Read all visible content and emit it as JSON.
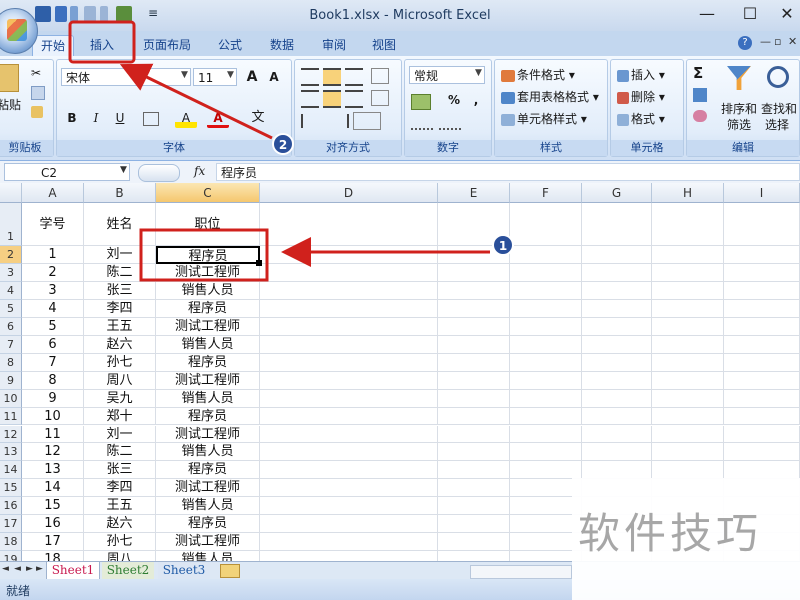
{
  "window": {
    "title": "Book1.xlsx - Microsoft Excel",
    "minimize": "—",
    "restore": "☐",
    "close": "✕"
  },
  "ribbon_controls": {
    "help": "?",
    "min": "—",
    "restore": "▫",
    "close": "✕"
  },
  "tabs": [
    {
      "label": "开始",
      "active": true
    },
    {
      "label": "插入",
      "active": false
    },
    {
      "label": "页面布局",
      "active": false
    },
    {
      "label": "公式",
      "active": false
    },
    {
      "label": "数据",
      "active": false
    },
    {
      "label": "审阅",
      "active": false
    },
    {
      "label": "视图",
      "active": false
    }
  ],
  "ribbon": {
    "clipboard": {
      "paste": "粘贴",
      "label": "剪贴板"
    },
    "font": {
      "name": "宋体",
      "size": "11",
      "grow": "A",
      "shrink": "A",
      "bold": "B",
      "italic": "I",
      "underline": "U",
      "fill": "A",
      "color": "A",
      "phonetic": "文",
      "label": "字体"
    },
    "alignment": {
      "label": "对齐方式"
    },
    "number": {
      "format": "常规",
      "percent": "%",
      "comma": ",",
      "label": "数字"
    },
    "styles": {
      "conditional": "条件格式",
      "table": "套用表格格式",
      "cell": "单元格样式",
      "label": "样式"
    },
    "cells": {
      "insert": "插入",
      "delete": "删除",
      "format": "格式",
      "label": "单元格"
    },
    "editing": {
      "sigma": "Σ",
      "sort": "排序和",
      "sort2": "筛选",
      "find": "查找和",
      "find2": "选择",
      "label": "编辑"
    }
  },
  "formula_bar": {
    "name_box": "C2",
    "fx": "fx",
    "content": "程序员"
  },
  "columns": [
    "A",
    "B",
    "C",
    "D",
    "E",
    "F",
    "G",
    "H",
    "I"
  ],
  "row_numbers": [
    "1",
    "2",
    "3",
    "4",
    "5",
    "6",
    "7",
    "8",
    "9",
    "10",
    "11",
    "12",
    "13",
    "14",
    "15",
    "16",
    "17",
    "18",
    "19"
  ],
  "header_row": [
    "学号",
    "姓名",
    "职位"
  ],
  "rows": [
    [
      "1",
      "刘一",
      "程序员"
    ],
    [
      "2",
      "陈二",
      "测试工程师"
    ],
    [
      "3",
      "张三",
      "销售人员"
    ],
    [
      "4",
      "李四",
      "程序员"
    ],
    [
      "5",
      "王五",
      "测试工程师"
    ],
    [
      "6",
      "赵六",
      "销售人员"
    ],
    [
      "7",
      "孙七",
      "程序员"
    ],
    [
      "8",
      "周八",
      "测试工程师"
    ],
    [
      "9",
      "吴九",
      "销售人员"
    ],
    [
      "10",
      "郑十",
      "程序员"
    ],
    [
      "11",
      "刘一",
      "测试工程师"
    ],
    [
      "12",
      "陈二",
      "销售人员"
    ],
    [
      "13",
      "张三",
      "程序员"
    ],
    [
      "14",
      "李四",
      "测试工程师"
    ],
    [
      "15",
      "王五",
      "销售人员"
    ],
    [
      "16",
      "赵六",
      "程序员"
    ],
    [
      "17",
      "孙七",
      "测试工程师"
    ],
    [
      "18",
      "周八",
      "销售人员"
    ]
  ],
  "sheets": [
    "Sheet1",
    "Sheet2",
    "Sheet3"
  ],
  "status": {
    "ready": "就绪"
  },
  "annotations": {
    "badge1": "1",
    "badge2": "2"
  },
  "watermark": "软件技巧",
  "colors": {
    "highlight_red": "#d0211c",
    "ribbon_blue": "#15428b",
    "selected_header": "#f5c76e"
  }
}
